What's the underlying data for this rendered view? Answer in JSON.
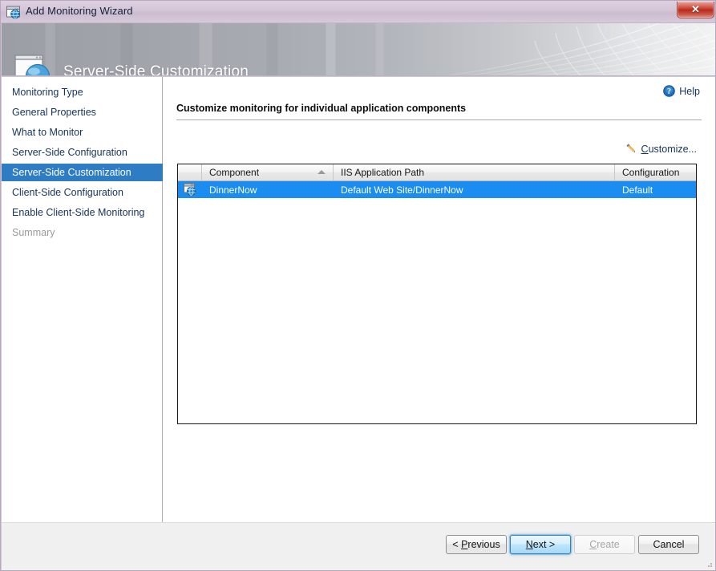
{
  "window": {
    "title": "Add Monitoring Wizard",
    "titlebar_icon": "web-application-icon",
    "close_label": "✕",
    "close_icon": "close-icon"
  },
  "banner": {
    "title": "Server-Side Customization",
    "icon": "web-application-icon"
  },
  "sidebar": {
    "items": [
      {
        "label": "Monitoring Type",
        "state": "normal"
      },
      {
        "label": "General Properties",
        "state": "normal"
      },
      {
        "label": "What to Monitor",
        "state": "normal"
      },
      {
        "label": "Server-Side Configuration",
        "state": "normal"
      },
      {
        "label": "Server-Side Customization",
        "state": "selected"
      },
      {
        "label": "Client-Side Configuration",
        "state": "normal"
      },
      {
        "label": "Enable Client-Side Monitoring",
        "state": "normal"
      },
      {
        "label": "Summary",
        "state": "disabled"
      }
    ]
  },
  "content": {
    "help_label": "Help",
    "help_icon": "help-question-icon",
    "heading": "Customize monitoring for individual application components",
    "customize": {
      "label_prefix": "",
      "accel": "C",
      "label_rest": "ustomize...",
      "icon": "pencil-icon"
    },
    "grid": {
      "columns": [
        {
          "key": "icon",
          "label": "",
          "sorted": false
        },
        {
          "key": "component",
          "label": "Component",
          "sorted": true,
          "sort_direction": "ascending"
        },
        {
          "key": "path",
          "label": "IIS Application Path",
          "sorted": false
        },
        {
          "key": "configuration",
          "label": "Configuration",
          "sorted": false
        }
      ],
      "rows": [
        {
          "icon": "web-application-icon",
          "component": "DinnerNow",
          "path": "Default Web Site/DinnerNow",
          "configuration": "Default",
          "selected": true
        }
      ]
    }
  },
  "footer": {
    "buttons": [
      {
        "name": "previous",
        "prefix": "< ",
        "accel": "P",
        "rest": "revious",
        "state": "normal"
      },
      {
        "name": "next",
        "prefix": "",
        "accel": "N",
        "rest": "ext >",
        "state": "default"
      },
      {
        "name": "create",
        "prefix": "",
        "accel": "C",
        "rest": "reate",
        "state": "disabled"
      },
      {
        "name": "cancel",
        "prefix": "",
        "accel": "",
        "rest": "Cancel",
        "state": "normal"
      }
    ]
  },
  "colors": {
    "titlebar": "#d3c5d6",
    "selection_blue": "#1b8df0",
    "nav_selected_blue": "#2e7cc4",
    "nav_text": "#16335c",
    "close_red": "#c4392c"
  }
}
